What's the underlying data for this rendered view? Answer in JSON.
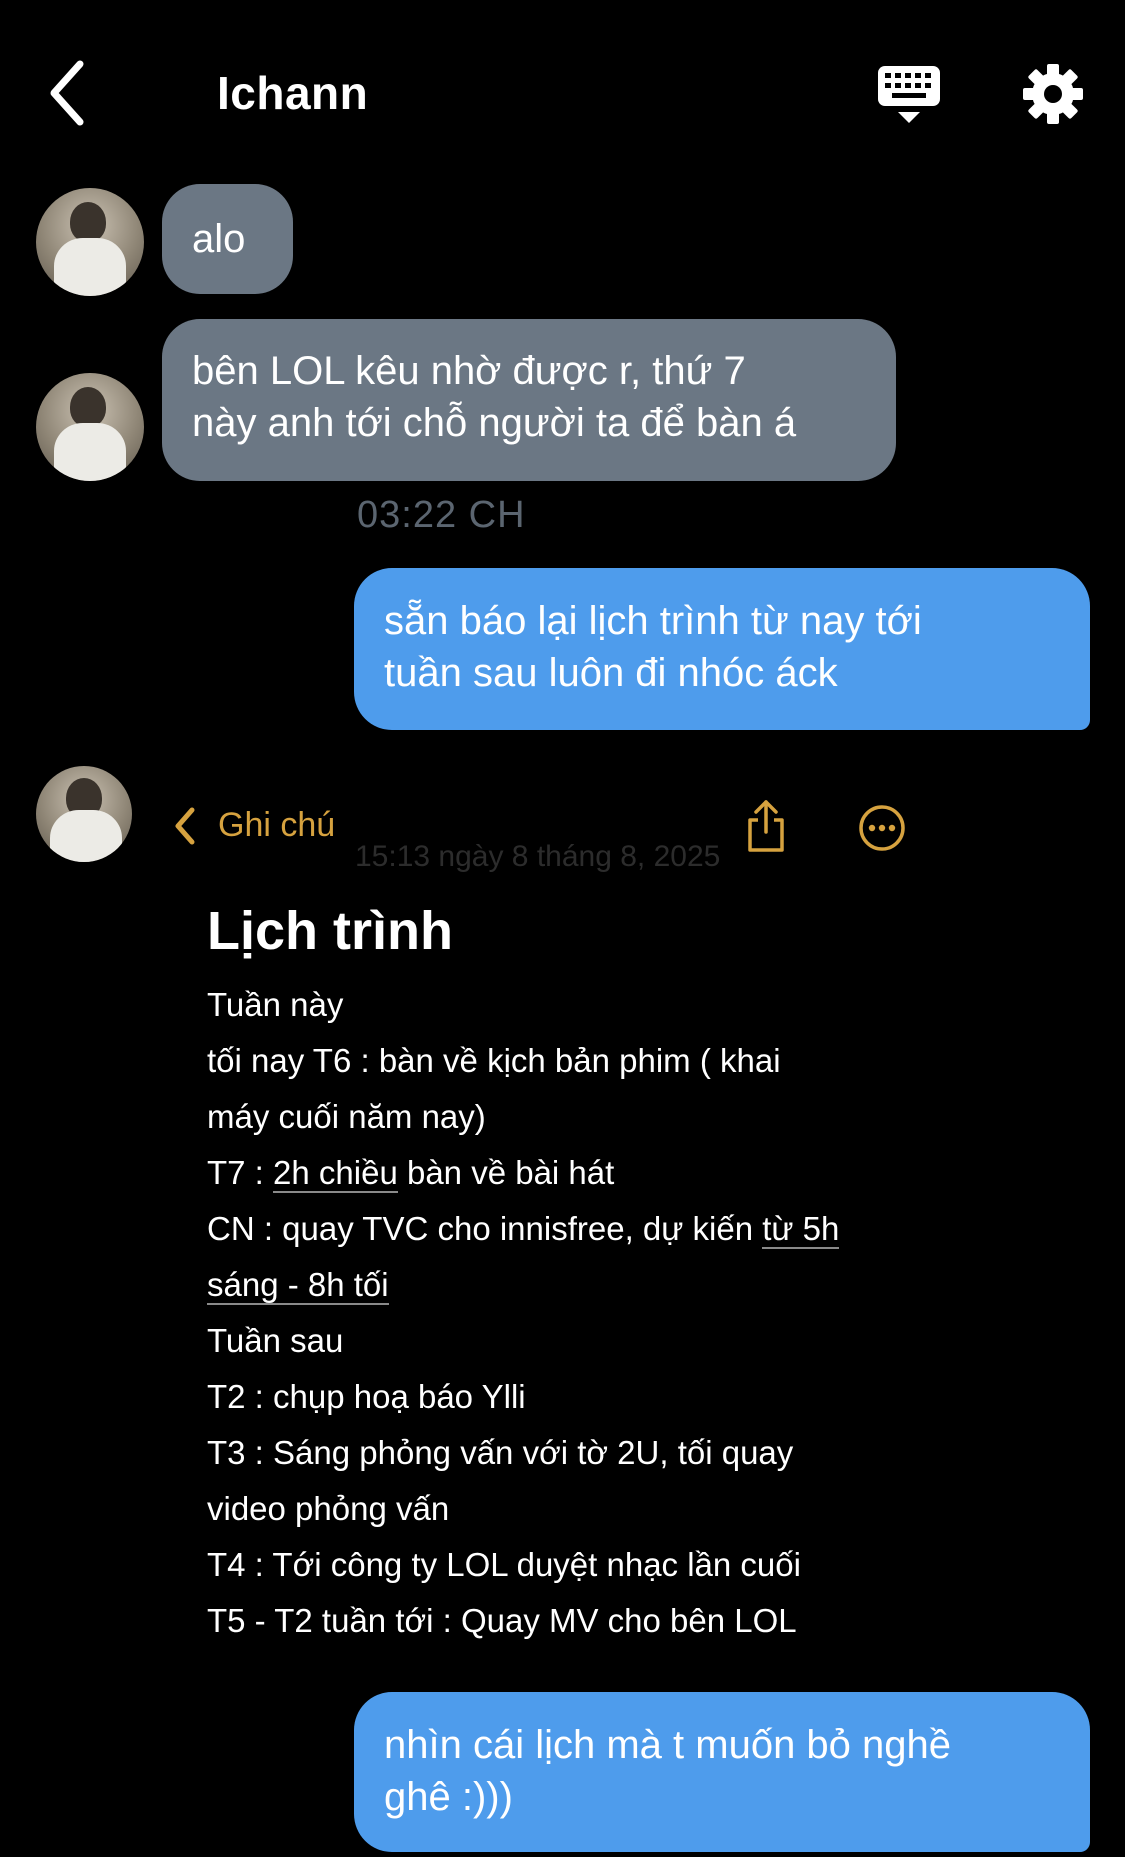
{
  "header": {
    "title": "Ichann",
    "back_icon": "chevron-left-icon",
    "keyboard_icon": "keyboard-icon",
    "settings_icon": "gear-icon"
  },
  "messages": {
    "m1": "alo",
    "m2_line1": "bên LOL kêu nhờ được r, thứ 7",
    "m2_line2": "này anh tới chỗ người ta để bàn á",
    "time": "03:22 CH",
    "m3_line1": "sẵn báo lại lịch trình từ nay tới",
    "m3_line2": "tuần sau luôn đi nhóc áck",
    "m4_line1": "nhìn cái lịch mà t muốn bỏ nghề",
    "m4_line2": "ghê :)))"
  },
  "note": {
    "back_label": "Ghi chú",
    "date": "15:13 ngày 8 tháng 8, 2025",
    "heading": "Lịch trình",
    "l1": "Tuần này",
    "l2": "tối nay T6 : bàn về kịch bản phim ( khai",
    "l3": "máy cuối năm nay)",
    "l4a": "T7 : ",
    "l4b": "2h chiều",
    "l4c": " bàn về bài hát",
    "l5a": "CN : quay TVC cho innisfree, dự kiến ",
    "l5b": "từ 5h",
    "l6": "sáng - 8h tối",
    "l7": "Tuần sau",
    "l8": "T2 : chụp hoạ báo Ylli",
    "l9": "T3 : Sáng phỏng vấn với tờ 2U, tối quay",
    "l10": "video phỏng vấn",
    "l11": "T4 : Tới công ty LOL duyệt nhạc lần cuối",
    "l12": "T5 - T2 tuần tới : Quay MV cho bên LOL"
  },
  "colors": {
    "incoming_bubble": "#6b7784",
    "outgoing_bubble": "#4e9cec",
    "notes_accent": "#d6a23f",
    "background": "#000000"
  }
}
